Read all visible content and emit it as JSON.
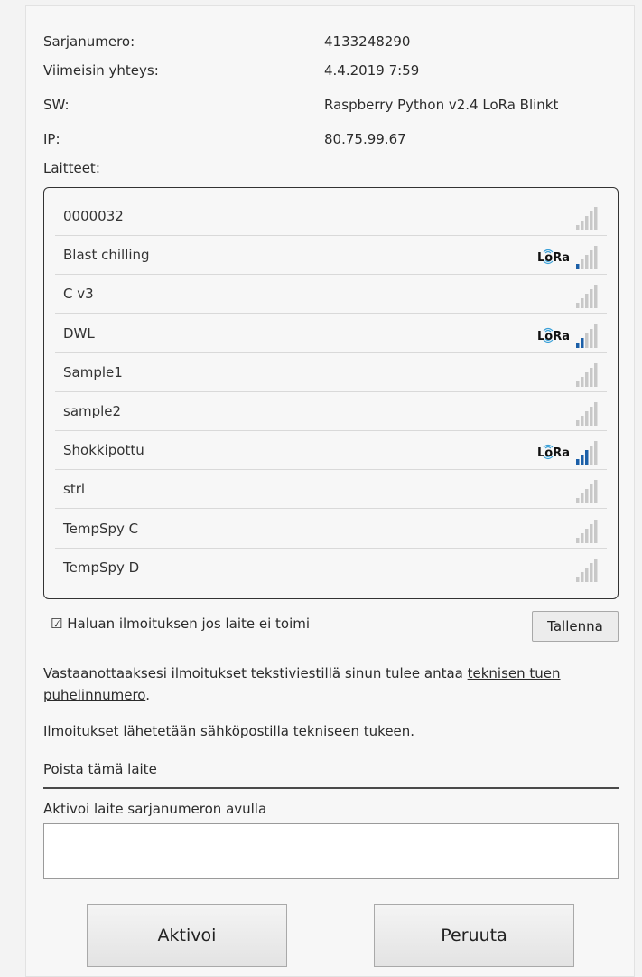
{
  "info": {
    "serial_label": "Sarjanumero:",
    "serial_value": "4133248290",
    "last_conn_label": "Viimeisin yhteys:",
    "last_conn_value": "4.4.2019 7:59",
    "sw_label": "SW:",
    "sw_value": "Raspberry Python v2.4 LoRa Blinkt",
    "ip_label": "IP:",
    "ip_value": "80.75.99.67",
    "devices_label": "Laitteet:"
  },
  "devices": [
    {
      "name": "0000032",
      "lora": false,
      "signal_bars": 0
    },
    {
      "name": "Blast chilling",
      "lora": true,
      "signal_bars": 1
    },
    {
      "name": "C v3",
      "lora": false,
      "signal_bars": 0
    },
    {
      "name": "DWL",
      "lora": true,
      "signal_bars": 2
    },
    {
      "name": "Sample1",
      "lora": false,
      "signal_bars": 0
    },
    {
      "name": "sample2",
      "lora": false,
      "signal_bars": 0
    },
    {
      "name": "Shokkipottu",
      "lora": true,
      "signal_bars": 3
    },
    {
      "name": "strl",
      "lora": false,
      "signal_bars": 0
    },
    {
      "name": "TempSpy C",
      "lora": false,
      "signal_bars": 0
    },
    {
      "name": "TempSpy D",
      "lora": false,
      "signal_bars": 0
    }
  ],
  "lora_badge_text": "LoRa",
  "notify": {
    "checkbox_glyph": "☑",
    "label": "Haluan ilmoituksen jos laite ei toimi",
    "checked": true,
    "save_label": "Tallenna"
  },
  "sms_note": {
    "before": "Vastaanottaaksesi ilmoitukset tekstiviestillä sinun tulee antaa ",
    "link": "teknisen tuen puhelinnumero",
    "after": "."
  },
  "email_note": "Ilmoitukset lähetetään sähköpostilla tekniseen tukeen.",
  "remove_label": "Poista tämä laite",
  "activate": {
    "label": "Aktivoi laite sarjanumeron avulla",
    "input_value": "",
    "activate_button": "Aktivoi",
    "cancel_button": "Peruuta"
  },
  "colors": {
    "signal_active": "#1b5fa8",
    "signal_inactive": "#c8c8c8",
    "lora_waves": "#3aa0d8"
  }
}
